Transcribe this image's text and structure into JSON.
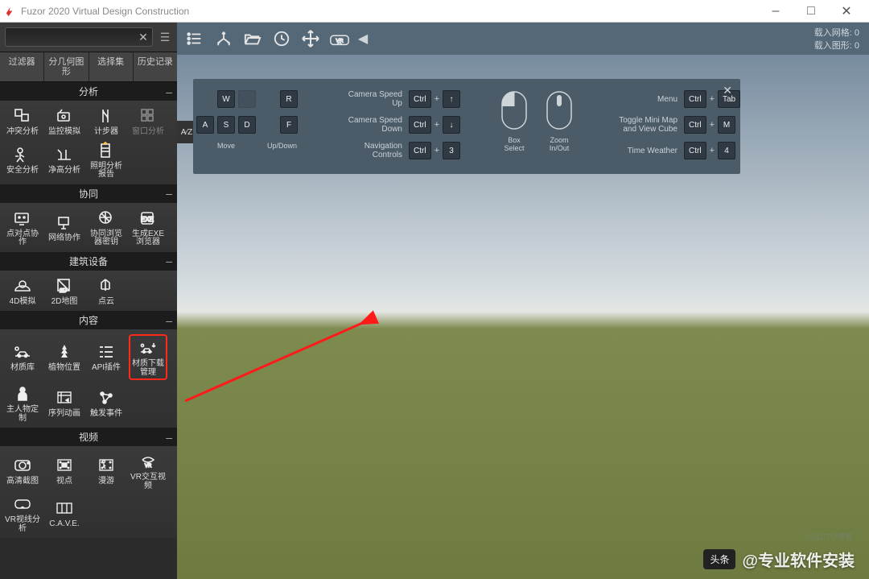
{
  "window": {
    "title": "Fuzor 2020 Virtual Design Construction"
  },
  "search": {
    "placeholder": ""
  },
  "tabs": [
    "过滤器",
    "分几何图\n形",
    "选择集",
    "历史记录"
  ],
  "sections": [
    {
      "title": "分析",
      "items": [
        {
          "label": "冲突分析"
        },
        {
          "label": "监控模拟"
        },
        {
          "label": "计步器"
        },
        {
          "label": "窗口分析",
          "dim": true
        },
        {
          "label": "安全分析"
        },
        {
          "label": "净高分析"
        },
        {
          "label": "照明分析\n报告"
        }
      ]
    },
    {
      "title": "协同",
      "items": [
        {
          "label": "点对点协\n作"
        },
        {
          "label": "网络协作"
        },
        {
          "label": "协同浏览\n器密钥"
        },
        {
          "label": "生成EXE\n浏览器"
        }
      ]
    },
    {
      "title": "建筑设备",
      "items": [
        {
          "label": "4D模拟"
        },
        {
          "label": "2D地图"
        },
        {
          "label": "点云"
        }
      ]
    },
    {
      "title": "内容",
      "items": [
        {
          "label": "材质库"
        },
        {
          "label": "植物位置"
        },
        {
          "label": "API插件"
        },
        {
          "label": "材质下载\n管理",
          "hl": true
        },
        {
          "label": "主人物定\n制"
        },
        {
          "label": "序列动画"
        },
        {
          "label": "触发事件"
        }
      ]
    },
    {
      "title": "视频",
      "items": [
        {
          "label": "高清截图"
        },
        {
          "label": "视点"
        },
        {
          "label": "漫游"
        },
        {
          "label": "VR交互视\n频"
        },
        {
          "label": "VR视线分\n析"
        },
        {
          "label": "C.A.V.E."
        }
      ]
    }
  ],
  "status": {
    "grid": "载入网格: 0",
    "shape": "载入图形: 0"
  },
  "help": {
    "wasd_label": "Move",
    "rf_label": "Up/Down",
    "rows_left": [
      {
        "label": "Camera Speed Up",
        "k": [
          "Ctrl",
          "+",
          "↑"
        ]
      },
      {
        "label": "Camera Speed Down",
        "k": [
          "Ctrl",
          "+",
          "↓"
        ]
      },
      {
        "label": "Navigation Controls",
        "k": [
          "Ctrl",
          "+",
          "3"
        ]
      }
    ],
    "mouse1": "Box Select",
    "mouse2": "Zoom\nIn/Out",
    "rows_right": [
      {
        "label": "Menu",
        "k": [
          "Ctrl",
          "+",
          "Tab"
        ]
      },
      {
        "label": "Toggle Mini Map\nand View Cube",
        "k": [
          "Ctrl",
          "+",
          "M"
        ]
      },
      {
        "label": "Time Weather",
        "k": [
          "Ctrl",
          "+",
          "4"
        ]
      }
    ]
  },
  "watermark": {
    "a": "头条",
    "b": "@专业软件安装",
    "c": "©51CTO博客"
  }
}
